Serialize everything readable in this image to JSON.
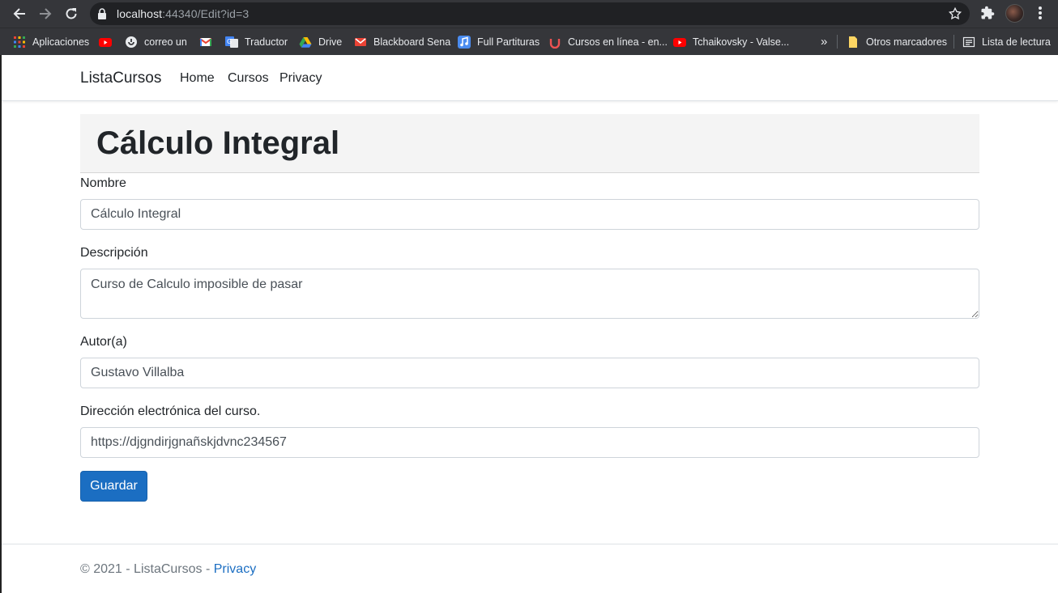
{
  "browser": {
    "url_host": "localhost",
    "url_path": ":44340/Edit?id=3",
    "bookmarks": [
      {
        "label": "Aplicaciones",
        "icon": "apps-grid-icon"
      },
      {
        "label": "",
        "icon": "youtube-icon"
      },
      {
        "label": "correo un",
        "icon": "mail-globe-icon"
      },
      {
        "label": "",
        "icon": "gmail-icon"
      },
      {
        "label": "Traductor",
        "icon": "translate-icon"
      },
      {
        "label": "Drive",
        "icon": "drive-icon"
      },
      {
        "label": "Blackboard Sena",
        "icon": "gmail-icon"
      },
      {
        "label": "Full Partituras",
        "icon": "music-icon"
      },
      {
        "label": "Cursos en línea - en...",
        "icon": "udemy-icon"
      },
      {
        "label": "Tchaikovsky - Valse...",
        "icon": "youtube-icon"
      }
    ],
    "overflow_label": "»",
    "other_bookmarks": "Otros marcadores",
    "reading_list": "Lista de lectura"
  },
  "navbar": {
    "brand": "ListaCursos",
    "links": [
      "Home",
      "Cursos",
      "Privacy"
    ]
  },
  "page": {
    "heading": "Cálculo Integral"
  },
  "form": {
    "nombre_label": "Nombre",
    "nombre_value": "Cálculo Integral",
    "descripcion_label": "Descripción",
    "descripcion_value": "Curso de Calculo imposible de pasar",
    "autor_label": "Autor(a)",
    "autor_value": "Gustavo Villalba",
    "direccion_label": "Dirección electrónica del curso.",
    "direccion_value": "https://djgndirjgnañskjdvnc234567",
    "save_label": "Guardar"
  },
  "footer": {
    "text": "© 2021 - ListaCursos - ",
    "privacy_link": "Privacy"
  },
  "colors": {
    "primary": "#1b6ec2",
    "chrome_bg": "#35363a",
    "omnibox_bg": "#202124"
  }
}
